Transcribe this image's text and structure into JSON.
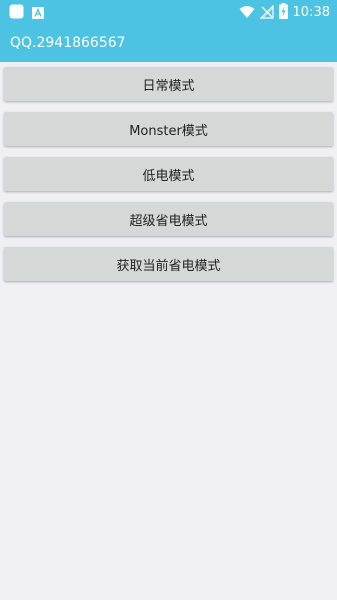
{
  "status_bar": {
    "time": "10:38",
    "notification_icons": [
      "app-icon",
      "font-a-icon"
    ],
    "system_icons": [
      "wifi-icon",
      "no-signal-icon",
      "battery-charging-icon"
    ]
  },
  "toolbar": {
    "title": "QQ.2941866567"
  },
  "buttons": [
    {
      "label": "日常模式"
    },
    {
      "label": "Monster模式"
    },
    {
      "label": "低电模式"
    },
    {
      "label": "超级省电模式"
    },
    {
      "label": "获取当前省电模式"
    }
  ],
  "colors": {
    "accent": "#4dc3e3",
    "background": "#efeff4",
    "button": "#d6d7d7",
    "button_text": "#222222"
  }
}
